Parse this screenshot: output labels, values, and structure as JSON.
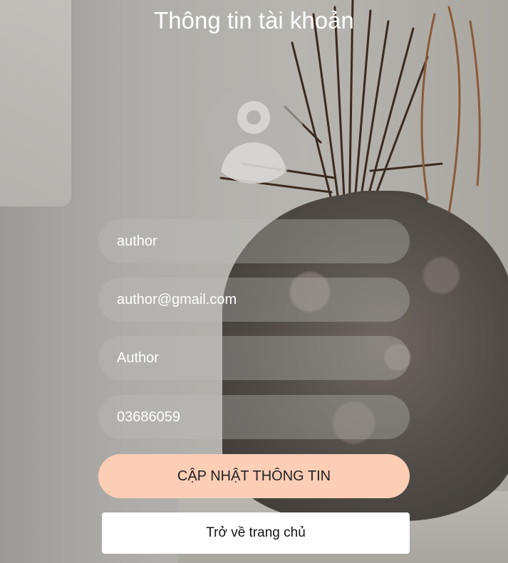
{
  "page": {
    "title": "Thông tin tài khoản"
  },
  "form": {
    "username": "author",
    "email": "author@gmail.com",
    "full_name": "Author",
    "phone": "03686059"
  },
  "actions": {
    "update_label": "CẬP NHẬT THÔNG TIN",
    "home_label": "Trở về trang chủ"
  },
  "colors": {
    "primary_button": "#fcceb5",
    "secondary_button": "#ffffff",
    "title_text": "#ffffff"
  },
  "icons": {
    "avatar": "user-avatar-icon"
  }
}
